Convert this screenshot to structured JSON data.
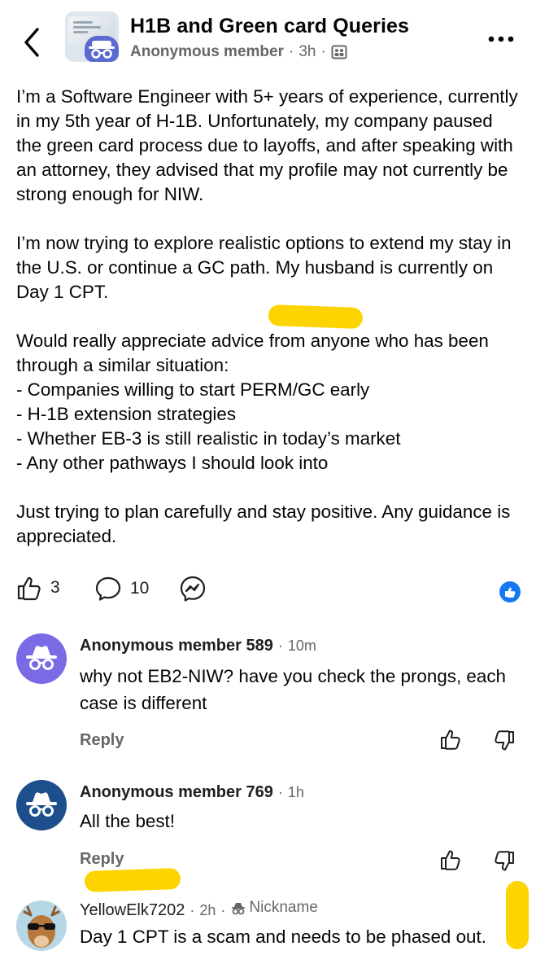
{
  "header": {
    "group_name": "H1B and Green card Queries",
    "author": "Anonymous member",
    "time": "3h",
    "separator": "·"
  },
  "post": {
    "paragraphs": [
      "I’m a Software Engineer with 5+ years of experience, currently in my 5th year of H-1B. Unfortunately, my company paused the green card process due to layoffs, and after speaking with an attorney, they advised that my profile may not currently be strong enough for NIW.",
      "I’m now trying to explore realistic options to extend my stay in the U.S. or continue a GC path. My husband is currently on Day 1 CPT.",
      "Would really appreciate advice from anyone who has been through a similar situation:\n- Companies willing to start PERM/GC early\n- H-1B extension strategies\n- Whether EB-3 is still realistic in today’s market\n- Any other pathways I should look into",
      "Just trying to plan carefully and stay positive. Any guidance is appreciated."
    ],
    "likes_count": "3",
    "comments_count": "10"
  },
  "comments": [
    {
      "author": "Anonymous member 589",
      "time": "10m",
      "text": "why not EB2-NIW? have you check the prongs, each case is different",
      "reply_label": "Reply",
      "avatar_color": "#7b6ae6"
    },
    {
      "author": "Anonymous member 769",
      "time": "1h",
      "text": "All the best!",
      "reply_label": "Reply",
      "avatar_color": "#1d4f8c"
    },
    {
      "author": "YellowElk7202",
      "time": "2h",
      "badge": "Nickname",
      "text": "Day 1 CPT is a scam and needs to be phased out.",
      "avatar_color": "#b6d7e6"
    }
  ],
  "colors": {
    "highlight": "#fdd400",
    "secondary_text": "#65676b",
    "like_blue": "#1877f2"
  },
  "icons": [
    "back-arrow-icon",
    "more-icon",
    "privacy-icon",
    "like-icon",
    "comment-icon",
    "messenger-icon",
    "thumbs-up-icon",
    "thumbs-down-icon",
    "incognito-icon",
    "sunglasses-icon"
  ]
}
